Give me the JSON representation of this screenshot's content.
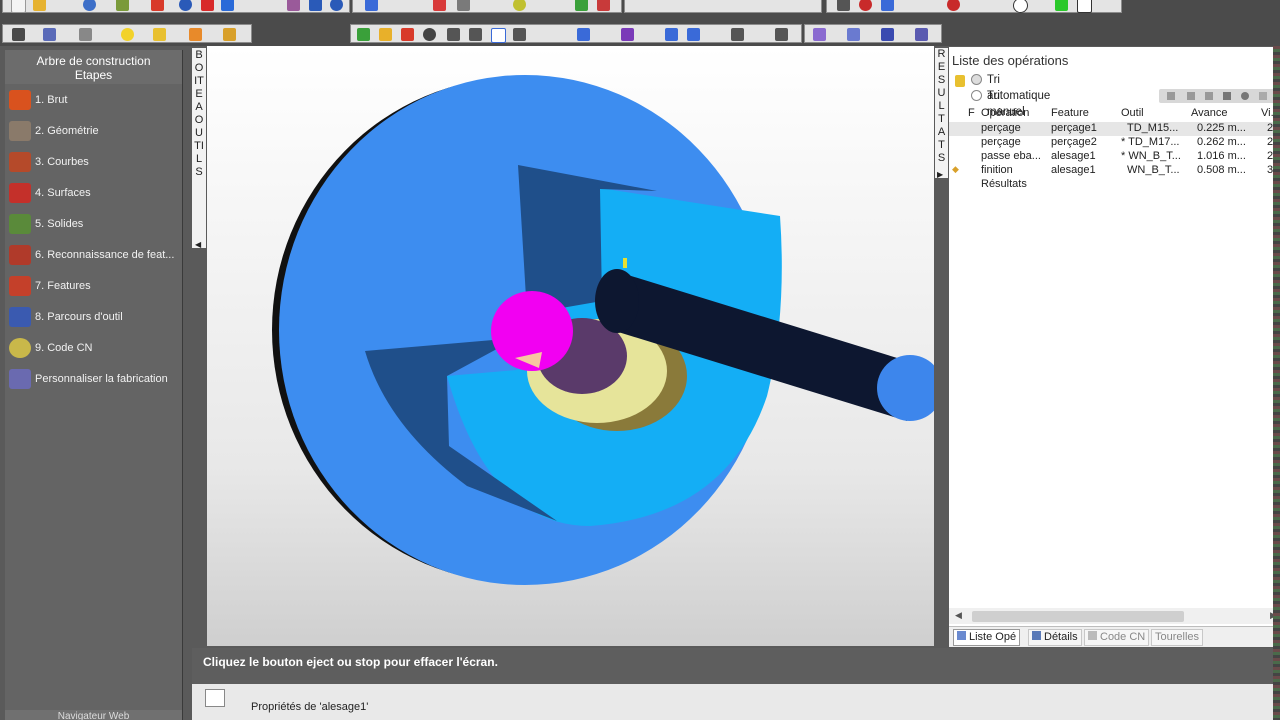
{
  "left_panel": {
    "title": "Arbre de construction",
    "subtitle": "Etapes",
    "steps": [
      {
        "label": "1.  Brut",
        "icon": "raw-stock-icon",
        "color": "#d9521e"
      },
      {
        "label": "2.  Géométrie",
        "icon": "geometry-icon",
        "color": "#8a7a6a"
      },
      {
        "label": "3.  Courbes",
        "icon": "curves-icon",
        "color": "#b54a2a"
      },
      {
        "label": "4.  Surfaces",
        "icon": "surfaces-icon",
        "color": "#c4302a"
      },
      {
        "label": "5.  Solides",
        "icon": "solids-icon",
        "color": "#5a8a3a"
      },
      {
        "label": "6.  Reconnaissance de feat...",
        "icon": "feature-recognition-icon",
        "color": "#b03a2a"
      },
      {
        "label": "7.  Features",
        "icon": "features-icon",
        "color": "#c4402a"
      },
      {
        "label": "8.  Parcours d'outil",
        "icon": "toolpath-icon",
        "color": "#3a5ab0"
      },
      {
        "label": "9.  Code CN",
        "icon": "nc-code-icon",
        "color": "#c9b84a"
      },
      {
        "label": "Personnaliser la fabrication",
        "icon": "customize-manufacturing-icon",
        "color": "#6a6ab0"
      }
    ],
    "bottom_label": "Navigateur Web"
  },
  "left_strip_text": "BOITE A OUTILS",
  "right_strip_text": "RESULTATS",
  "viewport": {
    "background_top": "#ffffff",
    "colors": {
      "stock": "#3d8df0",
      "cut_light": "#14aef5",
      "cut_dark": "#1f4f8a",
      "tool_body": "#0d1730",
      "tool_tip": "#3d86ec",
      "magenta": "#f200f2",
      "yellow": "#e6e49a"
    }
  },
  "operations": {
    "title": "Liste des opérations",
    "sort_auto": "Tri automatique",
    "sort_manual": "Tri manuel",
    "columns": [
      "F",
      "Opération",
      "Feature",
      "Outil",
      "Avance",
      "Vi..."
    ],
    "rows": [
      {
        "op": "perçage",
        "feature": "perçage1",
        "tool": "TD_M15...",
        "feed": "0.225 m...",
        "speed": "2..."
      },
      {
        "op": "perçage",
        "feature": "perçage2",
        "tool": "* TD_M17...",
        "feed": "0.262 m...",
        "speed": "2..."
      },
      {
        "op": "passe eba...",
        "feature": "alesage1",
        "tool": "* WN_B_T...",
        "feed": "1.016 m...",
        "speed": "2..."
      },
      {
        "op": "finition",
        "feature": "alesage1",
        "tool": "WN_B_T...",
        "feed": "0.508 m...",
        "speed": "3..."
      }
    ],
    "results_label": "Résultats",
    "tabs": [
      "Liste Opé",
      "Détails",
      "Code CN",
      "Tourelles"
    ]
  },
  "status": {
    "message": "Cliquez le bouton eject ou stop pour effacer l'écran.",
    "properties": "Propriétés de 'alesage1'"
  }
}
